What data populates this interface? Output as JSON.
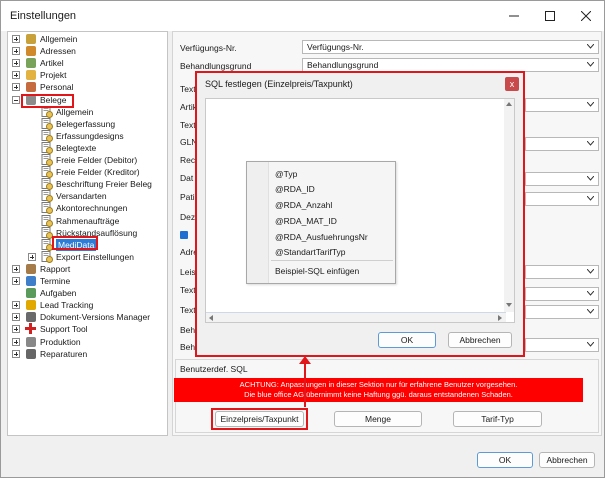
{
  "window": {
    "title": "Einstellungen"
  },
  "tree": {
    "items": [
      {
        "label": "Allgemein",
        "icon": "wrench-icon"
      },
      {
        "label": "Adressen",
        "icon": "address-book-icon"
      },
      {
        "label": "Artikel",
        "icon": "tag-icon"
      },
      {
        "label": "Projekt",
        "icon": "folder-icon"
      },
      {
        "label": "Personal",
        "icon": "person-icon"
      },
      {
        "label": "Belege",
        "icon": "documents-icon"
      },
      {
        "label": "Allgemein",
        "icon": "doc-gear-icon"
      },
      {
        "label": "Belegerfassung",
        "icon": "doc-gear-icon"
      },
      {
        "label": "Erfassungdesigns",
        "icon": "doc-gear-icon"
      },
      {
        "label": "Belegtexte",
        "icon": "doc-gear-icon"
      },
      {
        "label": "Freie Felder (Debitor)",
        "icon": "doc-gear-icon"
      },
      {
        "label": "Freie Felder (Kreditor)",
        "icon": "doc-gear-icon"
      },
      {
        "label": "Beschriftung Freier Beleg",
        "icon": "doc-gear-icon"
      },
      {
        "label": "Versandarten",
        "icon": "doc-gear-icon"
      },
      {
        "label": "Akontorechnungen",
        "icon": "doc-gear-icon"
      },
      {
        "label": "Rahmenaufträge",
        "icon": "doc-gear-icon"
      },
      {
        "label": "Rückstandsauflösung",
        "icon": "doc-gear-icon"
      },
      {
        "label": "MediData",
        "icon": "doc-gear-icon"
      },
      {
        "label": "Export Einstellungen",
        "icon": "doc-gear-icon"
      },
      {
        "label": "Rapport",
        "icon": "clipboard-icon"
      },
      {
        "label": "Termine",
        "icon": "calendar-icon"
      },
      {
        "label": "Aufgaben",
        "icon": "task-icon"
      },
      {
        "label": "Lead Tracking",
        "icon": "lightning-icon"
      },
      {
        "label": "Dokument-Versions Manager",
        "icon": "document-icon"
      },
      {
        "label": "Support Tool",
        "icon": "red-cross-icon"
      },
      {
        "label": "Produktion",
        "icon": "gear-icon"
      },
      {
        "label": "Reparaturen",
        "icon": "tools-icon"
      }
    ]
  },
  "form": {
    "fields": [
      {
        "label": "Verfügungs-Nr.",
        "value": "Verfügungs-Nr."
      },
      {
        "label": "Behandlungsgrund",
        "value": "Behandlungsgrund"
      }
    ],
    "partial_labels": [
      "Text",
      "Artik",
      "Text",
      "GLN",
      "Rec",
      "Dat",
      "Pati",
      "Dez",
      "Adre",
      "Leist",
      "Text",
      "Text",
      "Beh",
      "Beha"
    ],
    "section_title": "Benutzerdef. SQL",
    "warning_line1": "ACHTUNG: Anpassungen in dieser Sektion nur für erfahrene Benutzer vorgesehen.",
    "warning_line2": "Die blue office AG übernimmt keine Haftung ggü. daraus entstandenen Schaden.",
    "buttons": {
      "einzelpreis": "Einzelpreis/Taxpunkt",
      "menge": "Menge",
      "tarif": "Tarif-Typ"
    }
  },
  "dialog": {
    "title": "SQL festlegen (Einzelpreis/Taxpunkt)",
    "close_glyph": "x",
    "menu_items": [
      "@Typ",
      "@RDA_ID",
      "@RDA_Anzahl",
      "@RDA_MAT_ID",
      "@RDA_AusfuehrungsNr",
      "@StandartTarifTyp"
    ],
    "menu_footer": "Beispiel-SQL einfügen",
    "ok": "OK",
    "cancel": "Abbrechen"
  },
  "footer": {
    "ok": "OK",
    "cancel": "Abbrechen"
  },
  "colors": {
    "highlight_red": "#e0161b",
    "selection_blue": "#2d7cd6",
    "warning_red": "#ff0000"
  }
}
